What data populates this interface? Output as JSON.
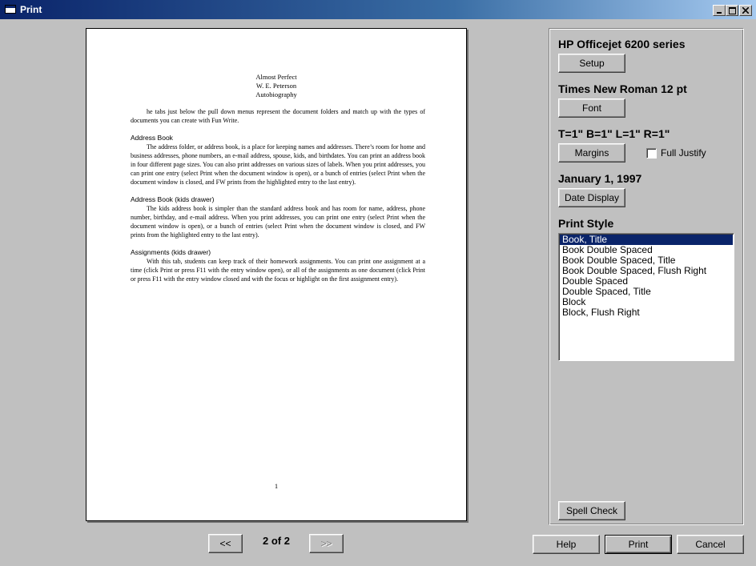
{
  "window": {
    "title": "Print"
  },
  "document": {
    "title_lines": [
      "Almost Perfect",
      "W. E. Peterson",
      "Autobiography"
    ],
    "intro": "he tabs just below the pull down menus represent the document folders and match up with the types of documents you can create with Fun Write.",
    "sections": [
      {
        "heading": "Address Book",
        "text": "The address folder, or address book, is a place for keeping names and addresses. There’s room for home and business addresses, phone numbers, an e-mail address, spouse, kids, and birthdates. You can print an address book in four different page sizes. You can also print addresses on various sizes of labels. When you print addresses, you can print one entry (select Print when the document window is open), or a bunch of entries (select Print when the document window is closed, and FW prints from the highlighted entry to the last entry)."
      },
      {
        "heading": "Address Book (kids drawer)",
        "text": "The kids address book is simpler than the standard address book and has room for name, address, phone number, birthday, and e-mail address. When you print addresses, you can print one entry (select Print when the document window is open), or a bunch of entries (select Print when the document window is closed, and FW prints from the highlighted entry to the last entry)."
      },
      {
        "heading": "Assignments (kids drawer)",
        "text": "With this tab, students can keep track of their homework assignments. You can print one assignment at a time (click Print or press F11 with the entry window open), or all of the assignments as one document (click Print or press F11 with the entry window closed and with the focus or highlight on the first assignment entry)."
      }
    ],
    "page_number": "1"
  },
  "pager": {
    "prev_label": "<<",
    "status": "2 of 2",
    "next_label": ">>"
  },
  "settings": {
    "printer_name": "HP Officejet 6200 series",
    "setup_label": "Setup",
    "font_name": "Times New Roman 12 pt",
    "font_label": "Font",
    "margins_text": "T=1\" B=1\" L=1\" R=1\"",
    "margins_label": "Margins",
    "full_justify_label": "Full Justify",
    "full_justify_checked": false,
    "date_text": "January 1, 1997",
    "date_display_label": "Date Display",
    "print_style_label": "Print Style",
    "print_styles": [
      "Book, Title",
      "Book Double Spaced",
      "Book Double Spaced, Title",
      "Book Double Spaced, Flush Right",
      "Double Spaced",
      "Double Spaced, Title",
      "Block",
      "Block, Flush Right"
    ],
    "selected_style": "Book, Title",
    "spell_check_label": "Spell Check"
  },
  "footer": {
    "help_label": "Help",
    "print_label": "Print",
    "cancel_label": "Cancel"
  },
  "colors": {
    "title_bar": "#0a246a",
    "selection": "#0a246a",
    "face": "#c0c0c0"
  }
}
